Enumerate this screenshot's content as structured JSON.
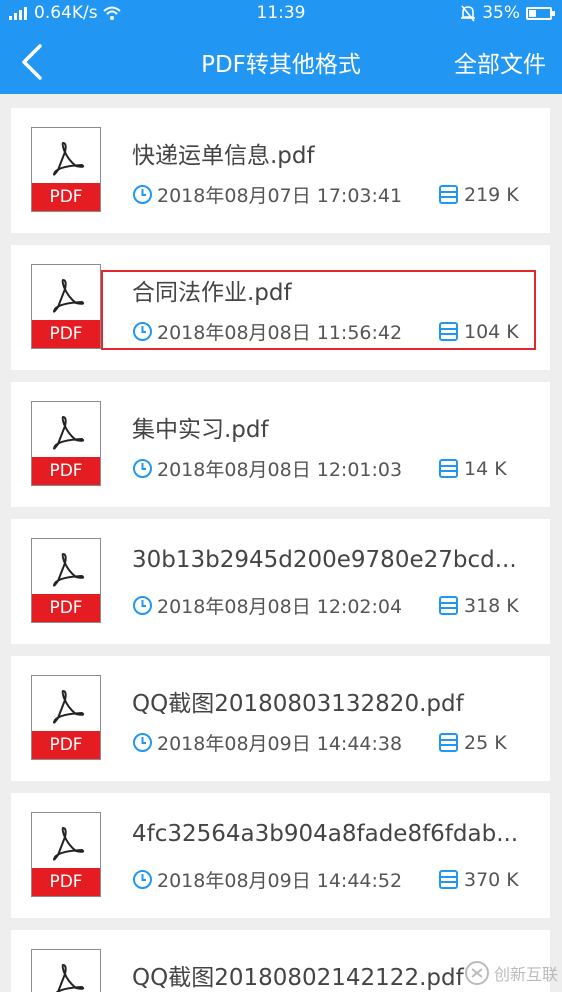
{
  "status": {
    "signal": "⁲ᴵᴵl",
    "speed": "0.64K/s",
    "time": "11:39",
    "battery_pct": "35%"
  },
  "header": {
    "title": "PDF转其他格式",
    "all_files_label": "全部文件"
  },
  "files": [
    {
      "name": "快递运单信息.pdf",
      "datetime": "2018年08月07日 17:03:41",
      "size": "219 K",
      "icon_label": "PDF"
    },
    {
      "name": "合同法作业.pdf",
      "datetime": "2018年08月08日 11:56:42",
      "size": "104 K",
      "icon_label": "PDF"
    },
    {
      "name": "集中实习.pdf",
      "datetime": "2018年08月08日 12:01:03",
      "size": "14 K",
      "icon_label": "PDF"
    },
    {
      "name": "30b13b2945d200e9780e27bcd...",
      "datetime": "2018年08月08日 12:02:04",
      "size": "318 K",
      "icon_label": "PDF"
    },
    {
      "name": "QQ截图20180803132820.pdf",
      "datetime": "2018年08月09日 14:44:38",
      "size": "25 K",
      "icon_label": "PDF"
    },
    {
      "name": "4fc32564a3b904a8fade8f6fdab...",
      "datetime": "2018年08月09日 14:44:52",
      "size": "370 K",
      "icon_label": "PDF"
    },
    {
      "name": "QQ截图20180802142122.pdf",
      "datetime": "",
      "size": "",
      "icon_label": ""
    }
  ],
  "watermark": "创新互联",
  "colors": {
    "accent": "#2196f3",
    "pdf_red": "#e51d23",
    "highlight": "#e0282d"
  }
}
